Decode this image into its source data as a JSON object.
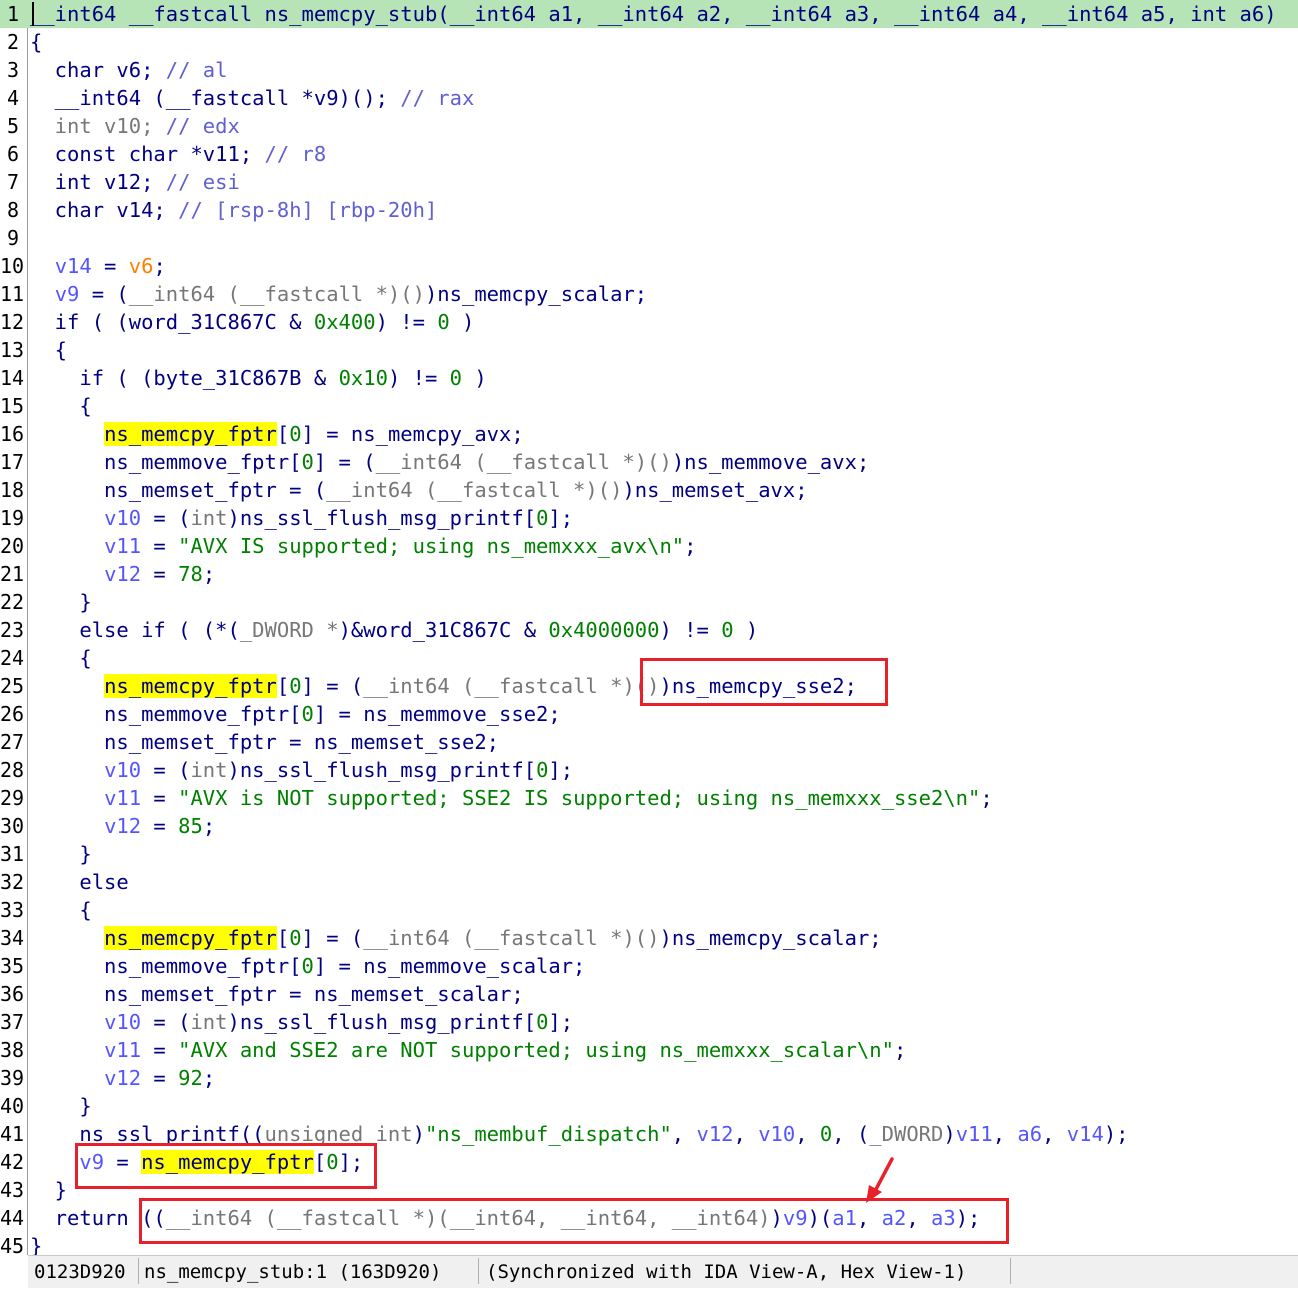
{
  "editor": {
    "lines": [
      {
        "n": "1",
        "hl": true,
        "toks": [
          [
            "k",
            "__int64 __fastcall ns_memcpy_stub(__int64 a1, __int64 a2, __int64 a3, __int64 a4, __int64 a5, int a6)"
          ]
        ]
      },
      {
        "n": "2",
        "toks": [
          [
            "k",
            "{"
          ]
        ]
      },
      {
        "n": "3",
        "toks": [
          [
            "k",
            "  char v6; "
          ],
          [
            "c",
            "// al"
          ]
        ]
      },
      {
        "n": "4",
        "toks": [
          [
            "k",
            "  __int64 (__fastcall *v9)(); "
          ],
          [
            "c",
            "// rax"
          ]
        ]
      },
      {
        "n": "5",
        "toks": [
          [
            "t",
            "  int v10; "
          ],
          [
            "c",
            "// edx"
          ]
        ]
      },
      {
        "n": "6",
        "toks": [
          [
            "k",
            "  const char *v11; "
          ],
          [
            "c",
            "// r8"
          ]
        ]
      },
      {
        "n": "7",
        "toks": [
          [
            "k",
            "  int v12; "
          ],
          [
            "c",
            "// esi"
          ]
        ]
      },
      {
        "n": "8",
        "toks": [
          [
            "k",
            "  char v14; "
          ],
          [
            "c",
            "// [rsp-8h] [rbp-20h]"
          ]
        ]
      },
      {
        "n": "9",
        "toks": [
          [
            "k",
            " "
          ]
        ]
      },
      {
        "n": "10",
        "toks": [
          [
            "k",
            "  "
          ],
          [
            "v",
            "v14"
          ],
          [
            "k",
            " = "
          ],
          [
            "o",
            "v6"
          ],
          [
            "k",
            ";"
          ]
        ]
      },
      {
        "n": "11",
        "toks": [
          [
            "k",
            "  "
          ],
          [
            "v",
            "v9"
          ],
          [
            "k",
            " = ("
          ],
          [
            "t",
            "__int64 (__fastcall *)()"
          ],
          [
            "k",
            ")ns_memcpy_scalar;"
          ]
        ]
      },
      {
        "n": "12",
        "toks": [
          [
            "k",
            "  if ( (word_31C867C & "
          ],
          [
            "n",
            "0x400"
          ],
          [
            "k",
            ") != "
          ],
          [
            "n",
            "0"
          ],
          [
            "k",
            " )"
          ]
        ]
      },
      {
        "n": "13",
        "toks": [
          [
            "k",
            "  {"
          ]
        ]
      },
      {
        "n": "14",
        "toks": [
          [
            "k",
            "    if ( (byte_31C867B & "
          ],
          [
            "n",
            "0x10"
          ],
          [
            "k",
            ") != "
          ],
          [
            "n",
            "0"
          ],
          [
            "k",
            " )"
          ]
        ]
      },
      {
        "n": "15",
        "toks": [
          [
            "k",
            "    {"
          ]
        ]
      },
      {
        "n": "16",
        "toks": [
          [
            "k",
            "      "
          ],
          [
            "y",
            "ns_memcpy_fptr"
          ],
          [
            "k",
            "["
          ],
          [
            "n",
            "0"
          ],
          [
            "k",
            "] = ns_memcpy_avx;"
          ]
        ]
      },
      {
        "n": "17",
        "toks": [
          [
            "k",
            "      ns_memmove_fptr["
          ],
          [
            "n",
            "0"
          ],
          [
            "k",
            "] = ("
          ],
          [
            "t",
            "__int64 (__fastcall *)()"
          ],
          [
            "k",
            ")ns_memmove_avx;"
          ]
        ]
      },
      {
        "n": "18",
        "toks": [
          [
            "k",
            "      ns_memset_fptr = ("
          ],
          [
            "t",
            "__int64 (__fastcall *)()"
          ],
          [
            "k",
            ")ns_memset_avx;"
          ]
        ]
      },
      {
        "n": "19",
        "toks": [
          [
            "k",
            "      "
          ],
          [
            "v",
            "v10"
          ],
          [
            "k",
            " = ("
          ],
          [
            "t",
            "int"
          ],
          [
            "k",
            ")ns_ssl_flush_msg_printf["
          ],
          [
            "n",
            "0"
          ],
          [
            "k",
            "];"
          ]
        ]
      },
      {
        "n": "20",
        "toks": [
          [
            "k",
            "      "
          ],
          [
            "v",
            "v11"
          ],
          [
            "k",
            " = "
          ],
          [
            "s",
            "\"AVX IS supported; using ns_memxxx_avx\\n\""
          ],
          [
            "k",
            ";"
          ]
        ]
      },
      {
        "n": "21",
        "toks": [
          [
            "k",
            "      "
          ],
          [
            "v",
            "v12"
          ],
          [
            "k",
            " = "
          ],
          [
            "n",
            "78"
          ],
          [
            "k",
            ";"
          ]
        ]
      },
      {
        "n": "22",
        "toks": [
          [
            "k",
            "    }"
          ]
        ]
      },
      {
        "n": "23",
        "toks": [
          [
            "k",
            "    else if ( (*("
          ],
          [
            "t",
            "_DWORD *"
          ],
          [
            "k",
            ")&word_31C867C & "
          ],
          [
            "n",
            "0x4000000"
          ],
          [
            "k",
            ") != "
          ],
          [
            "n",
            "0"
          ],
          [
            "k",
            " )"
          ]
        ]
      },
      {
        "n": "24",
        "toks": [
          [
            "k",
            "    {"
          ]
        ]
      },
      {
        "n": "25",
        "toks": [
          [
            "k",
            "      "
          ],
          [
            "y",
            "ns_memcpy_fptr"
          ],
          [
            "k",
            "["
          ],
          [
            "n",
            "0"
          ],
          [
            "k",
            "] = ("
          ],
          [
            "t",
            "__int64 (__fastcall *)()"
          ],
          [
            "k",
            ")ns_memcpy_sse2;"
          ]
        ]
      },
      {
        "n": "26",
        "toks": [
          [
            "k",
            "      ns_memmove_fptr["
          ],
          [
            "n",
            "0"
          ],
          [
            "k",
            "] = ns_memmove_sse2;"
          ]
        ]
      },
      {
        "n": "27",
        "toks": [
          [
            "k",
            "      ns_memset_fptr = ns_memset_sse2;"
          ]
        ]
      },
      {
        "n": "28",
        "toks": [
          [
            "k",
            "      "
          ],
          [
            "v",
            "v10"
          ],
          [
            "k",
            " = ("
          ],
          [
            "t",
            "int"
          ],
          [
            "k",
            ")ns_ssl_flush_msg_printf["
          ],
          [
            "n",
            "0"
          ],
          [
            "k",
            "];"
          ]
        ]
      },
      {
        "n": "29",
        "toks": [
          [
            "k",
            "      "
          ],
          [
            "v",
            "v11"
          ],
          [
            "k",
            " = "
          ],
          [
            "s",
            "\"AVX is NOT supported; SSE2 IS supported; using ns_memxxx_sse2\\n\""
          ],
          [
            "k",
            ";"
          ]
        ]
      },
      {
        "n": "30",
        "toks": [
          [
            "k",
            "      "
          ],
          [
            "v",
            "v12"
          ],
          [
            "k",
            " = "
          ],
          [
            "n",
            "85"
          ],
          [
            "k",
            ";"
          ]
        ]
      },
      {
        "n": "31",
        "toks": [
          [
            "k",
            "    }"
          ]
        ]
      },
      {
        "n": "32",
        "toks": [
          [
            "k",
            "    else"
          ]
        ]
      },
      {
        "n": "33",
        "toks": [
          [
            "k",
            "    {"
          ]
        ]
      },
      {
        "n": "34",
        "toks": [
          [
            "k",
            "      "
          ],
          [
            "y",
            "ns_memcpy_fptr"
          ],
          [
            "k",
            "["
          ],
          [
            "n",
            "0"
          ],
          [
            "k",
            "] = ("
          ],
          [
            "t",
            "__int64 (__fastcall *)()"
          ],
          [
            "k",
            ")ns_memcpy_scalar;"
          ]
        ]
      },
      {
        "n": "35",
        "toks": [
          [
            "k",
            "      ns_memmove_fptr["
          ],
          [
            "n",
            "0"
          ],
          [
            "k",
            "] = ns_memmove_scalar;"
          ]
        ]
      },
      {
        "n": "36",
        "toks": [
          [
            "k",
            "      ns_memset_fptr = ns_memset_scalar;"
          ]
        ]
      },
      {
        "n": "37",
        "toks": [
          [
            "k",
            "      "
          ],
          [
            "v",
            "v10"
          ],
          [
            "k",
            " = ("
          ],
          [
            "t",
            "int"
          ],
          [
            "k",
            ")ns_ssl_flush_msg_printf["
          ],
          [
            "n",
            "0"
          ],
          [
            "k",
            "];"
          ]
        ]
      },
      {
        "n": "38",
        "toks": [
          [
            "k",
            "      "
          ],
          [
            "v",
            "v11"
          ],
          [
            "k",
            " = "
          ],
          [
            "s",
            "\"AVX and SSE2 are NOT supported; using ns_memxxx_scalar\\n\""
          ],
          [
            "k",
            ";"
          ]
        ]
      },
      {
        "n": "39",
        "toks": [
          [
            "k",
            "      "
          ],
          [
            "v",
            "v12"
          ],
          [
            "k",
            " = "
          ],
          [
            "n",
            "92"
          ],
          [
            "k",
            ";"
          ]
        ]
      },
      {
        "n": "40",
        "toks": [
          [
            "k",
            "    }"
          ]
        ]
      },
      {
        "n": "41",
        "toks": [
          [
            "k",
            "    ns_ssl_printf(("
          ],
          [
            "t",
            "unsigned int"
          ],
          [
            "k",
            ")"
          ],
          [
            "s",
            "\"ns_membuf_dispatch\""
          ],
          [
            "k",
            ", "
          ],
          [
            "v",
            "v12"
          ],
          [
            "k",
            ", "
          ],
          [
            "v",
            "v10"
          ],
          [
            "k",
            ", "
          ],
          [
            "n",
            "0"
          ],
          [
            "k",
            ", ("
          ],
          [
            "t",
            "_DWORD"
          ],
          [
            "k",
            ")"
          ],
          [
            "v",
            "v11"
          ],
          [
            "k",
            ", "
          ],
          [
            "v",
            "a6"
          ],
          [
            "k",
            ", "
          ],
          [
            "v",
            "v14"
          ],
          [
            "k",
            ");"
          ]
        ]
      },
      {
        "n": "42",
        "toks": [
          [
            "k",
            "    "
          ],
          [
            "v",
            "v9"
          ],
          [
            "k",
            " = "
          ],
          [
            "y",
            "ns_memcpy_fptr"
          ],
          [
            "k",
            "["
          ],
          [
            "n",
            "0"
          ],
          [
            "k",
            "];"
          ]
        ]
      },
      {
        "n": "43",
        "toks": [
          [
            "k",
            "  }"
          ]
        ]
      },
      {
        "n": "44",
        "toks": [
          [
            "k",
            "  return (("
          ],
          [
            "t",
            "__int64 (__fastcall *)(__int64, __int64, __int64)"
          ],
          [
            "k",
            ")"
          ],
          [
            "v",
            "v9"
          ],
          [
            "k",
            ")("
          ],
          [
            "v",
            "a1"
          ],
          [
            "k",
            ", "
          ],
          [
            "v",
            "a2"
          ],
          [
            "k",
            ", "
          ],
          [
            "v",
            "a3"
          ],
          [
            "k",
            ");"
          ]
        ]
      },
      {
        "n": "45",
        "toks": [
          [
            "k",
            "}"
          ]
        ]
      }
    ]
  },
  "status": {
    "address": "0123D920",
    "location": "ns_memcpy_stub:1 (163D920)",
    "sync": "(Synchronized with IDA View-A, Hex View-1)"
  },
  "colors": {
    "line_highlight": "#b7e4b7",
    "search_highlight": "#ffff00",
    "annotation_red": "#e8202a"
  }
}
